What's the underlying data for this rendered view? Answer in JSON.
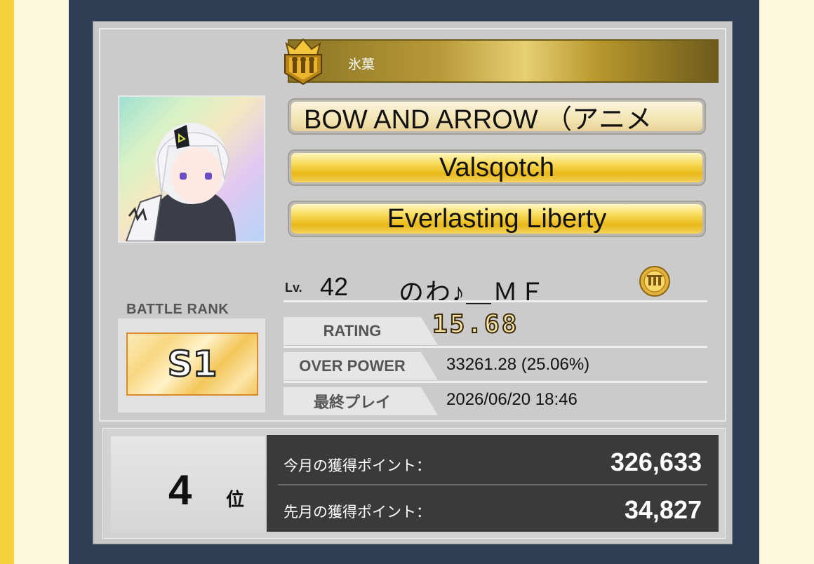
{
  "team": {
    "name": "氷菓"
  },
  "titles": [
    {
      "text": "BOW AND ARROW （アニメ"
    },
    {
      "text": "Valsqotch"
    },
    {
      "text": "Everlasting Liberty"
    }
  ],
  "player": {
    "level_label": "Lv.",
    "level": "42",
    "name": "のわ♪＿ＭＦ"
  },
  "battle_rank": {
    "label": "BATTLE RANK",
    "value": "S1"
  },
  "stats": {
    "rating_label": "RATING",
    "rating_value": "15.68",
    "over_power_label": "OVER POWER",
    "over_power_value": "33261.28 (25.06%)",
    "last_play_label": "最終プレイ",
    "last_play_value": "2026/06/20 18:46"
  },
  "ranking": {
    "position": "4",
    "position_suffix": "位",
    "this_month_label": "今月の獲得ポイント：",
    "this_month_value": "326,633",
    "last_month_label": "先月の獲得ポイント：",
    "last_month_value": "34,827"
  },
  "colors": {
    "frame": "#2f3d55",
    "gold_plate": "#f8dc5c",
    "points_panel": "#3a3a3a"
  }
}
